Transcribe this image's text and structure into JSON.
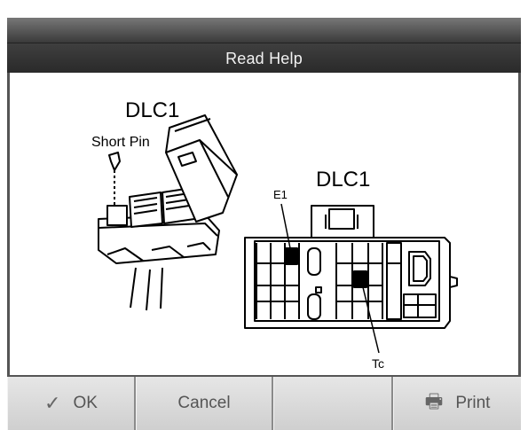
{
  "window": {
    "title": "Read Help"
  },
  "diagram": {
    "left_title": "DLC1",
    "short_pin_label": "Short Pin",
    "right_title": "DLC1",
    "pin_e1_label": "E1",
    "pin_tc_label": "Tc"
  },
  "buttons": {
    "ok": "OK",
    "ok_icon": "checkmark-icon",
    "cancel": "Cancel",
    "blank": "",
    "print": "Print",
    "print_icon": "printer-icon"
  }
}
